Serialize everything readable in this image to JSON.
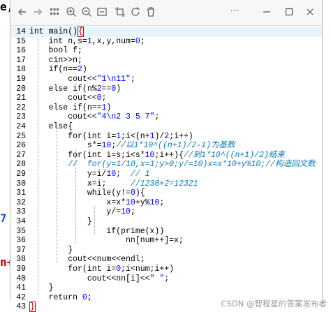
{
  "edge_fragments": {
    "top": "e,",
    "middle": "7",
    "bottom": "n+"
  },
  "toolbar": {
    "icons": [
      "back-arrow-icon",
      "forward-arrow-icon",
      "grid-icon",
      "zoom-in-icon",
      "zoom-out-icon",
      "fit-window-icon",
      "crop-icon",
      "rotate-icon",
      "delete-icon",
      "more-icon",
      "minimize-icon",
      "maximize-icon",
      "close-icon"
    ]
  },
  "code": {
    "lines": [
      {
        "n": "14",
        "text": "int main(){"
      },
      {
        "n": "15",
        "text": "    int n,s=1,x,y,num=0;"
      },
      {
        "n": "16",
        "text": "    bool f;"
      },
      {
        "n": "17",
        "text": "    cin>>n;"
      },
      {
        "n": "18",
        "text": "    if(n==2)"
      },
      {
        "n": "19",
        "text": "        cout<<\"1\\n11\";"
      },
      {
        "n": "20",
        "text": "    else if(n%2==0)"
      },
      {
        "n": "21",
        "text": "        cout<<0;"
      },
      {
        "n": "22",
        "text": "    else if(n==1)"
      },
      {
        "n": "23",
        "text": "        cout<<\"4\\n2 3 5 7\";"
      },
      {
        "n": "24",
        "text": "    else{"
      },
      {
        "n": "25",
        "text": "        for(int i=1;i<(n+1)/2;i++)"
      },
      {
        "n": "26",
        "text": "            s*=10;//以1*10^((n+1)/2-1)为基数"
      },
      {
        "n": "27",
        "text": "        for(int i=s;i<s*10;i++){//到1*10^((n+1)/2)结束"
      },
      {
        "n": "28",
        "text": "        //  for(y=1/10,x=1;y>0;y/=10)x=x*10+y%10;//构造回文数"
      },
      {
        "n": "29",
        "text": "            y=i/10;  // 1"
      },
      {
        "n": "30",
        "text": "            x=i;     //1230+2=12321"
      },
      {
        "n": "31",
        "text": "            while(y!=0){"
      },
      {
        "n": "32",
        "text": "                x=x*10+y%10;"
      },
      {
        "n": "33",
        "text": "                y/=10;"
      },
      {
        "n": "34",
        "text": "            }"
      },
      {
        "n": "35",
        "text": "                if(prime(x))"
      },
      {
        "n": "36",
        "text": "                    nn[num++]=x;"
      },
      {
        "n": "37",
        "text": "        }"
      },
      {
        "n": "38",
        "text": "        cout<<num<<endl;"
      },
      {
        "n": "39",
        "text": "        for(int i=0;i<num;i++)"
      },
      {
        "n": "40",
        "text": "            cout<<nn[i]<<\" \";"
      },
      {
        "n": "41",
        "text": "    }"
      },
      {
        "n": "42",
        "text": "    return 0;"
      },
      {
        "n": "43",
        "text": "}"
      }
    ]
  },
  "watermark": "CSDN @智程星的答案发布者",
  "colors": {
    "keyword": "#000000",
    "number": "#0000ff",
    "comment": "#0a7ab8",
    "highlight": "#e6f4fb",
    "brace_match": "#d00000"
  }
}
